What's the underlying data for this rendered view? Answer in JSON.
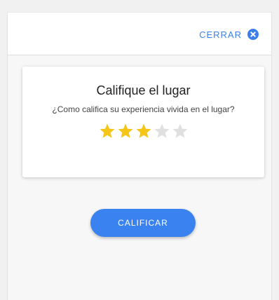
{
  "header": {
    "close_label": "CERRAR",
    "close_icon": "close-circle-icon"
  },
  "card": {
    "title": "Califique el lugar",
    "question": "¿Como califica su experiencia vivida en el lugar?",
    "rating": {
      "value": 3,
      "max": 5,
      "star_icon": "star-icon"
    }
  },
  "actions": {
    "rate_label": "CALIFICAR"
  },
  "colors": {
    "accent": "#3b82f1",
    "star_filled": "#f5c518",
    "star_empty": "#e0e0e0"
  }
}
